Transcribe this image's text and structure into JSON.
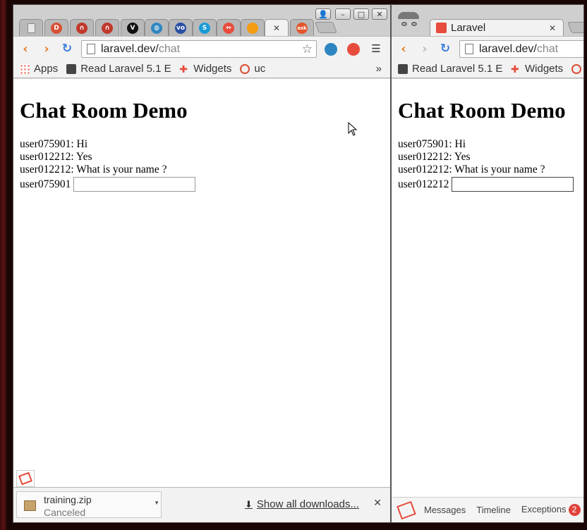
{
  "left_window": {
    "tabs": {
      "active_close": "✕",
      "favicons": [
        {
          "name": "blank-page-icon",
          "color": "#e8e8e8",
          "glyph": ""
        },
        {
          "name": "disqus-icon",
          "color": "#d94f35",
          "glyph": "D"
        },
        {
          "name": "laracasts-icon",
          "color": "#c0392b",
          "glyph": "∩"
        },
        {
          "name": "laracasts-icon",
          "color": "#c0392b",
          "glyph": "∩"
        },
        {
          "name": "vim-icon",
          "color": "#111111",
          "glyph": "V"
        },
        {
          "name": "globe-icon",
          "color": "#2e86c1",
          "glyph": "◍"
        },
        {
          "name": "vo-icon",
          "color": "#2a4fa3",
          "glyph": "vo"
        },
        {
          "name": "skype-icon",
          "color": "#1a9bd7",
          "glyph": "S"
        },
        {
          "name": "arrows-icon",
          "color": "#e74c3c",
          "glyph": "↔"
        },
        {
          "name": "orange-ball-icon",
          "color": "#f39c12",
          "glyph": ""
        },
        {
          "name": "ask-icon",
          "color": "#e3542a",
          "glyph": "ask"
        }
      ]
    },
    "url_host": "laravel.dev/",
    "url_path": "chat",
    "bookmarks": {
      "apps": "Apps",
      "read_laravel": "Read Laravel 5.1 E",
      "widgets": "Widgets",
      "uc": "uc",
      "overflow": "»"
    },
    "page": {
      "title": "Chat Room Demo",
      "messages": [
        "user075901: Hi",
        "user012212: Yes",
        "user012212: What is your name ?"
      ],
      "input_user": "user075901",
      "input_value": ""
    },
    "downloads": {
      "file_name": "training.zip",
      "status": "Canceled",
      "show_all": "Show all downloads...",
      "close": "✕"
    }
  },
  "right_window": {
    "tab_title": "Laravel",
    "tab_close": "✕",
    "url_host": "laravel.dev/",
    "url_path": "chat",
    "bookmarks": {
      "read_laravel": "Read Laravel 5.1 E",
      "widgets": "Widgets"
    },
    "page": {
      "title": "Chat Room Demo",
      "messages": [
        "user075901: Hi",
        "user012212: Yes",
        "user012212: What is your name ?"
      ],
      "input_user": "user012212",
      "input_value": ""
    },
    "debugbar": {
      "messages": "Messages",
      "timeline": "Timeline",
      "exceptions": "Exceptions",
      "exceptions_count": "2"
    }
  }
}
